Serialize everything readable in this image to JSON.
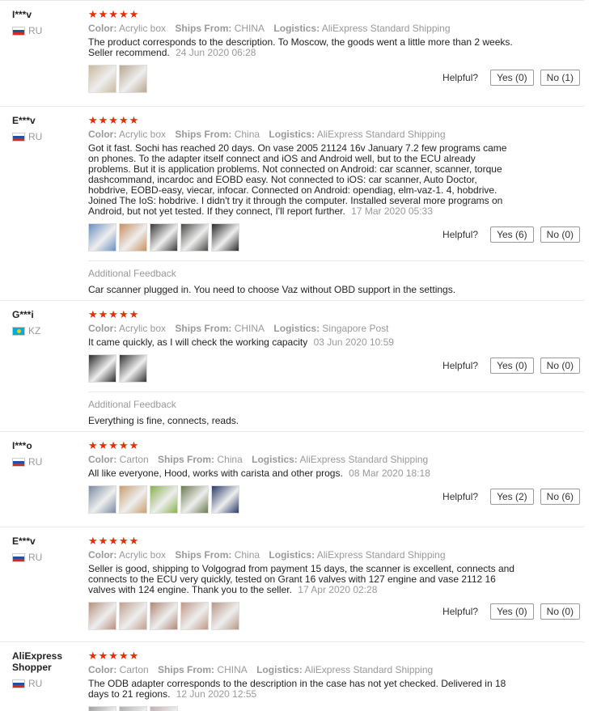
{
  "ui": {
    "stars": "★★★★★",
    "labels": {
      "color": "Color:",
      "ships_from": "Ships From:",
      "logistics": "Logistics:",
      "helpful": "Helpful?",
      "additional_feedback": "Additional Feedback"
    }
  },
  "reviews": [
    {
      "user": "I***v",
      "country": "RU",
      "color": "Acrylic box",
      "ships_from": "CHINA",
      "logistics": "AliExpress Standard Shipping",
      "text": "The product corresponds to the description. To Moscow, the goods went a little more than 2 weeks. Seller recommend.",
      "date": "24 Jun 2020 06:28",
      "yes": "Yes (0)",
      "no": "No (1)",
      "thumb_colors": [
        "#c9b9a0",
        "#b8a890"
      ]
    },
    {
      "user": "E***v",
      "country": "RU",
      "color": "Acrylic box",
      "ships_from": "China",
      "logistics": "AliExpress Standard Shipping",
      "text": "Got it fast. Sochi has reached 20 days. On vase 2005 21124 16v January 7.2 few programs came on phones. To the adapter itself connect and iOS and Android well, but to the ECU already problems. But it is application problems. Not connected on Android: car scanner, scanner, torque dashcommand, incardoc and EOBD easy. Not connected to iOS: car scanner, Auto Doctor, hobdrive, EOBD-easy, viecar, infocar. Connected on Android: opendiag, elm-vaz-1. 4, hobdrive. Joined The IoS: hobdrive. I didn't try it through the computer. Installed several more programs on Android, but not yet tested. If they connect, I'll report further.",
      "date": "17 Mar 2020 05:33",
      "yes": "Yes (6)",
      "no": "No (0)",
      "thumb_colors": [
        "#6a8fc0",
        "#c89060",
        "#3a3a3a",
        "#4a4a48",
        "#2a2a2a"
      ],
      "additional_text": "Car scanner plugged in. You need to choose Vaz without OBD support in the settings."
    },
    {
      "user": "G***i",
      "country": "KZ",
      "color": "Acrylic box",
      "ships_from": "CHINA",
      "logistics": "Singapore Post",
      "text": "It came quickly, as I will check the working capacity",
      "date": "03 Jun 2020 10:59",
      "yes": "Yes (0)",
      "no": "No (0)",
      "thumb_colors": [
        "#2a2a2a",
        "#333333"
      ],
      "additional_text": "Everything is fine, connects, reads."
    },
    {
      "user": "I***o",
      "country": "RU",
      "color": "Carton",
      "ships_from": "China",
      "logistics": "AliExpress Standard Shipping",
      "text": "All like everyone, Hood, works with carista and other progs.",
      "date": "08 Mar 2020 18:18",
      "yes": "Yes (2)",
      "no": "No (6)",
      "thumb_colors": [
        "#7a8aa0",
        "#c8a070",
        "#8ab050",
        "#6a7a50",
        "#2a3a6a"
      ]
    },
    {
      "user": "E***v",
      "country": "RU",
      "color": "Acrylic box",
      "ships_from": "China",
      "logistics": "AliExpress Standard Shipping",
      "text": "Seller is good, shipping to Volgograd from payment 15 days, the scanner is excellent, connects and connects to the ECU very quickly, tested on Grant 16 valves with 127 engine and vase 2112 16 valves with 124 engine. Thank you to the seller.",
      "date": "17 Apr 2020 02:28",
      "yes": "Yes (0)",
      "no": "No (0)",
      "thumb_colors": [
        "#b89080",
        "#c0a090",
        "#b08878",
        "#c09888",
        "#b89888"
      ]
    },
    {
      "user": "AliExpress Shopper",
      "country": "RU",
      "color": "Carton",
      "ships_from": "CHINA",
      "logistics": "AliExpress Standard Shipping",
      "text": "The ODB adapter corresponds to the description in the case has not yet checked. Delivered in 18 days to 21 regions.",
      "date": "12 Jun 2020 12:55",
      "thumb_colors": [
        "#a0a0a0",
        "#b0b0b0",
        "#c0b0b0"
      ]
    }
  ]
}
